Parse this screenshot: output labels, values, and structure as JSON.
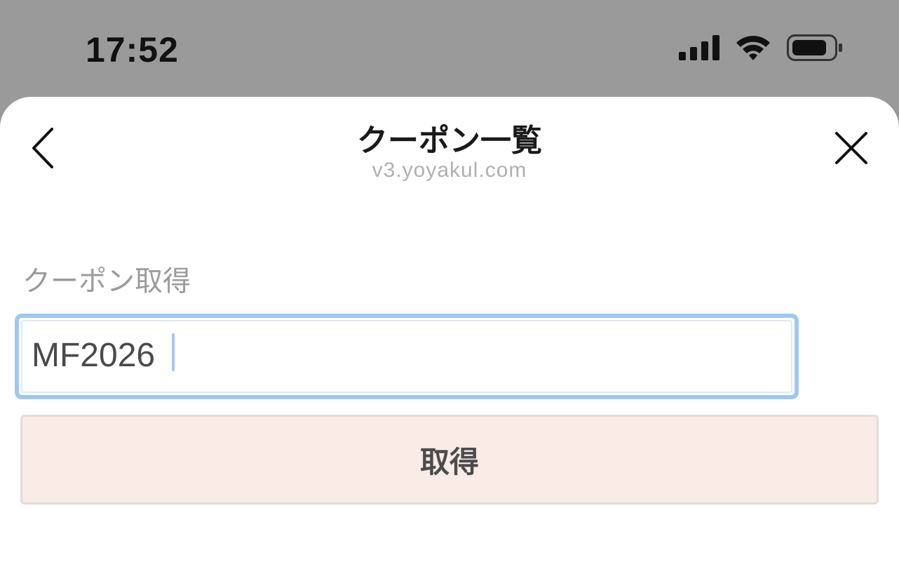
{
  "status_bar": {
    "time": "17:52",
    "icons": [
      "cellular-signal-icon",
      "wifi-icon",
      "battery-icon"
    ]
  },
  "header": {
    "title": "クーポン一覧",
    "subtitle": "v3.yoyakul.com",
    "back_icon": "chevron-left-icon",
    "close_icon": "close-icon"
  },
  "coupon_form": {
    "section_label": "クーポン取得",
    "code_value": "MF2026",
    "submit_label": "取得"
  },
  "colors": {
    "input_focus_border": "#9ec8f1",
    "button_background": "#f9ebe6",
    "status_bar_background": "#9a9a9a"
  }
}
